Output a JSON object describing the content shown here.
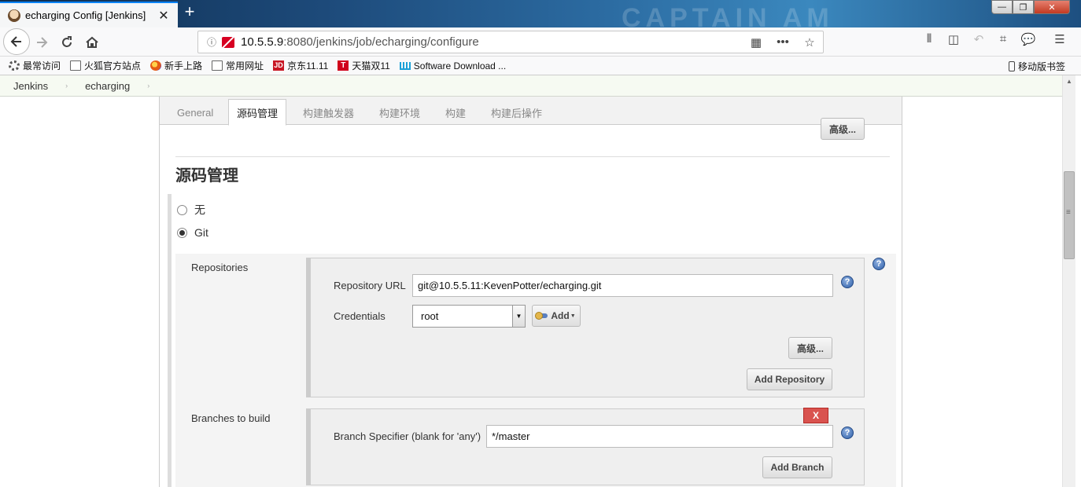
{
  "browser": {
    "tab_title": "echarging Config [Jenkins]",
    "tab_close": "✕",
    "new_tab": "+",
    "wallpaper_text": "CAPTAIN AM",
    "url_host": "10.5.5.9",
    "url_path": ":8080/jenkins/job/echarging/configure",
    "window_controls": {
      "minimize": "—",
      "maximize": "❐",
      "close": "✕"
    },
    "bookmarks": [
      {
        "label": "最常访问",
        "icon": "gear-icon"
      },
      {
        "label": "火狐官方站点",
        "icon": "folder-icon"
      },
      {
        "label": "新手上路",
        "icon": "firefox-icon"
      },
      {
        "label": "常用网址",
        "icon": "folder-icon"
      },
      {
        "label": "京东11.11",
        "icon": "jd-icon",
        "icon_text": "JD"
      },
      {
        "label": "天猫双11",
        "icon": "tmall-icon",
        "icon_text": "T"
      },
      {
        "label": "Software Download ...",
        "icon": "cisco-icon"
      }
    ],
    "mobile_bookmarks": "移动版书签"
  },
  "breadcrumb": {
    "items": [
      "Jenkins",
      "echarging"
    ],
    "separator": "›"
  },
  "config_tabs": {
    "items": [
      "General",
      "源码管理",
      "构建触发器",
      "构建环境",
      "构建",
      "构建后操作"
    ],
    "active": "源码管理"
  },
  "top_advanced_button": "高级...",
  "scm": {
    "section_title": "源码管理",
    "options": [
      "无",
      "Git"
    ],
    "selected": "Git",
    "repositories": {
      "label": "Repositories",
      "url_label": "Repository URL",
      "url_value": "git@10.5.5.11:KevenPotter/echarging.git",
      "credentials_label": "Credentials",
      "credentials_value": "root",
      "add_button": "Add",
      "advanced_button": "高级...",
      "add_repository_button": "Add Repository"
    },
    "branches": {
      "label": "Branches to build",
      "delete_button": "X",
      "specifier_label": "Branch Specifier (blank for 'any')",
      "specifier_value": "*/master",
      "add_branch_button": "Add Branch"
    },
    "help_glyph": "?"
  },
  "colors": {
    "breadcrumb_bg": "#f6faf2",
    "delete_button": "#d9534f",
    "help_icon": "#2e5fa8",
    "firefox_accent": "#0a84ff"
  }
}
